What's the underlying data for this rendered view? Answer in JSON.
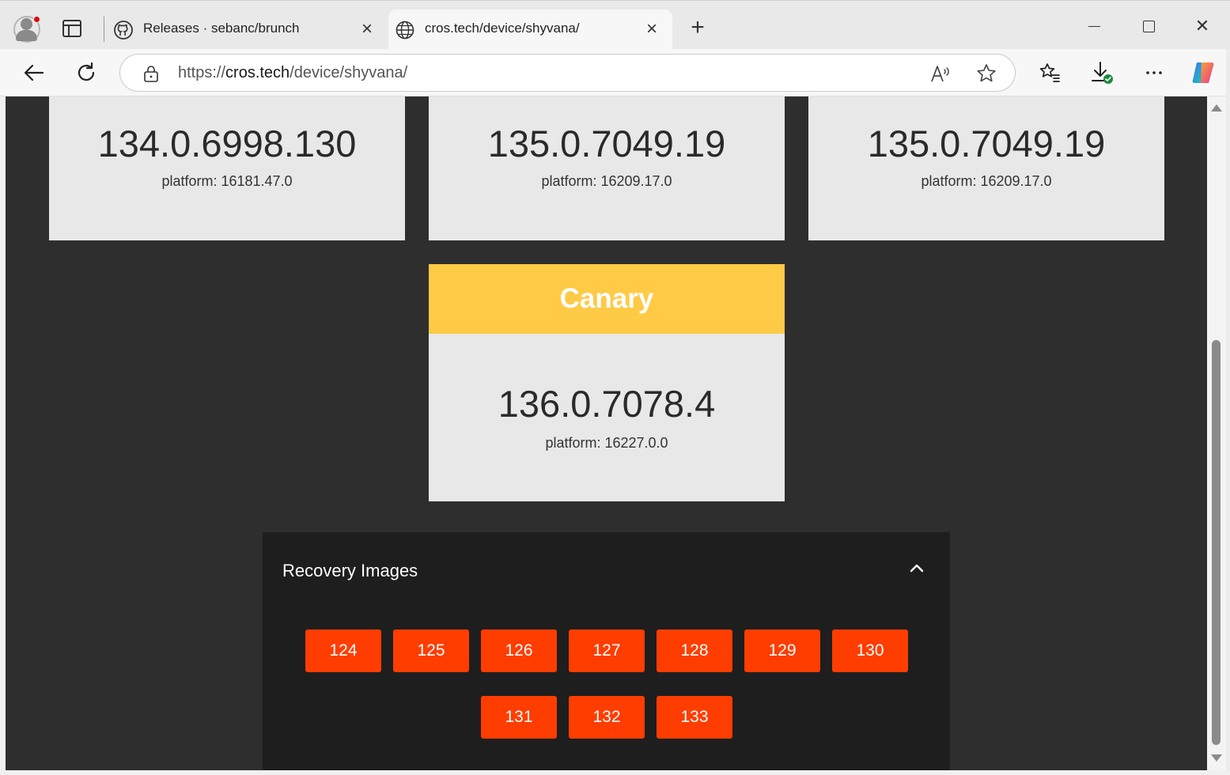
{
  "browser": {
    "tabs": [
      {
        "title": "Releases · sebanc/brunch",
        "icon": "github-icon",
        "active": false
      },
      {
        "title": "cros.tech/device/shyvana/",
        "icon": "globe-icon",
        "active": true
      }
    ],
    "new_tab_label": "+",
    "address": {
      "scheme": "https://",
      "host": "cros.tech",
      "path": "/device/shyvana/"
    },
    "icons": [
      "profile-icon",
      "tab-actions-icon",
      "back-icon",
      "refresh-icon",
      "lock-icon",
      "read-aloud-icon",
      "favorite-star-icon",
      "favorites-icon",
      "downloads-icon",
      "more-icon",
      "copilot-icon"
    ]
  },
  "channels": [
    {
      "version": "134.0.6998.130",
      "platform": "platform: 16181.47.0"
    },
    {
      "version": "135.0.7049.19",
      "platform": "platform: 16209.17.0"
    },
    {
      "version": "135.0.7049.19",
      "platform": "platform: 16209.17.0"
    }
  ],
  "canary": {
    "label": "Canary",
    "version": "136.0.7078.4",
    "platform": "platform: 16227.0.0",
    "color": "#ffca45"
  },
  "recovery": {
    "title": "Recovery Images",
    "expanded": true,
    "buttons": [
      "124",
      "125",
      "126",
      "127",
      "128",
      "129",
      "130",
      "131",
      "132",
      "133"
    ],
    "button_color": "#ff3d00"
  },
  "colors": {
    "page_background": "#2e2e2e",
    "card_background": "#e8e8e8",
    "panel_background": "#1e1e1e"
  }
}
